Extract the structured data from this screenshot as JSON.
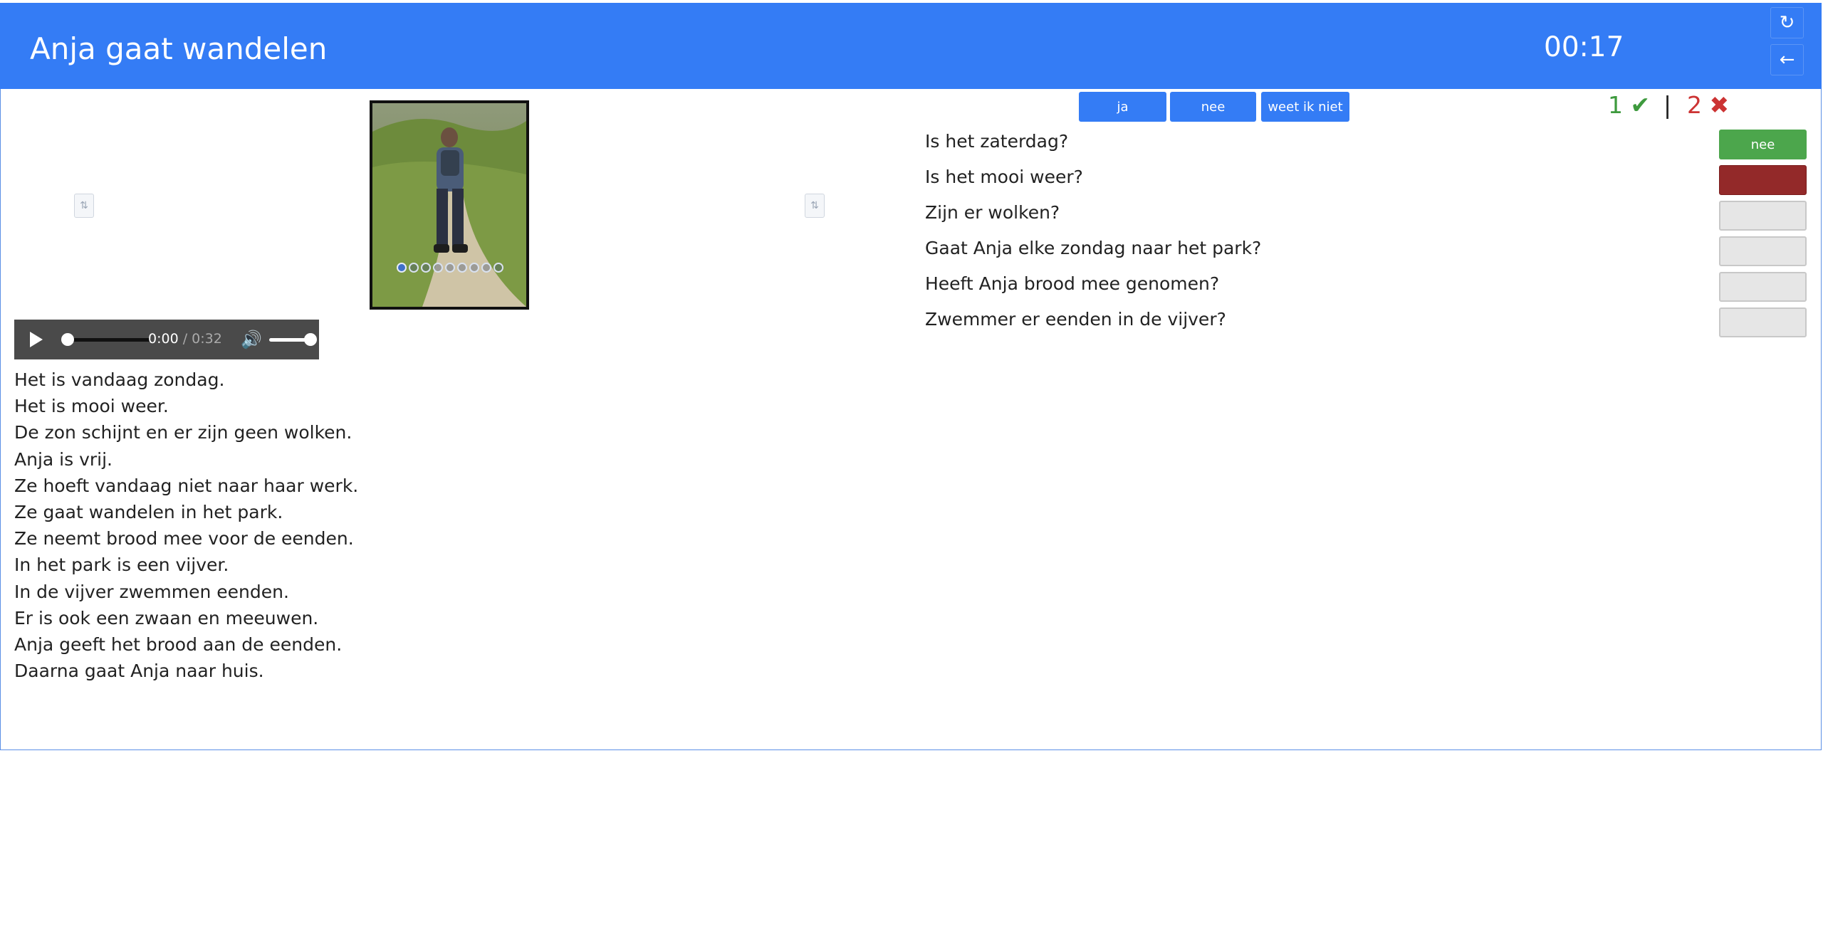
{
  "header": {
    "title": "Anja gaat wandelen",
    "timer": "00:17",
    "refresh_icon": "↻",
    "back_icon": "←"
  },
  "image_slider": {
    "description_icon": "hiker-photo",
    "total_dots": 9,
    "active_dot": 1
  },
  "audio": {
    "current_time": "0:00",
    "separator": " / ",
    "duration": "0:32",
    "progress": 0,
    "volume": 1
  },
  "story": {
    "lines": [
      "Het is vandaag zondag.",
      "Het is mooi weer.",
      "De zon schijnt en er zijn geen wolken.",
      "Anja is vrij.",
      "Ze hoeft vandaag niet naar haar werk.",
      "Ze gaat wandelen in het park.",
      "Ze neemt brood mee voor de eenden.",
      "In het park is een vijver.",
      "In de vijver zwemmen eenden.",
      "Er is ook een zwaan en meeuwen.",
      "Anja geeft het brood aan de eenden.",
      "Daarna gaat Anja naar huis."
    ]
  },
  "answer_buttons": {
    "yes": "ja",
    "no": "nee",
    "dont_know": "weet ik niet"
  },
  "score": {
    "correct": "1",
    "correct_icon": "✔",
    "separator": "|",
    "wrong": "2",
    "wrong_icon": "✖"
  },
  "questions": [
    {
      "text": "Is het zaterdag?",
      "answer": "nee",
      "status": "correct"
    },
    {
      "text": "Is het mooi weer?",
      "answer": "",
      "status": "wrong"
    },
    {
      "text": "Zijn er wolken?",
      "answer": "",
      "status": "empty"
    },
    {
      "text": "Gaat Anja elke zondag naar het park?",
      "answer": "",
      "status": "empty"
    },
    {
      "text": "Heeft Anja brood mee genomen?",
      "answer": "",
      "status": "empty"
    },
    {
      "text": "Zwemmer er eenden in de vijver?",
      "answer": "",
      "status": "empty"
    }
  ],
  "colors": {
    "header": "#347cf5",
    "correct": "#4ca64c",
    "wrong": "#932929"
  }
}
